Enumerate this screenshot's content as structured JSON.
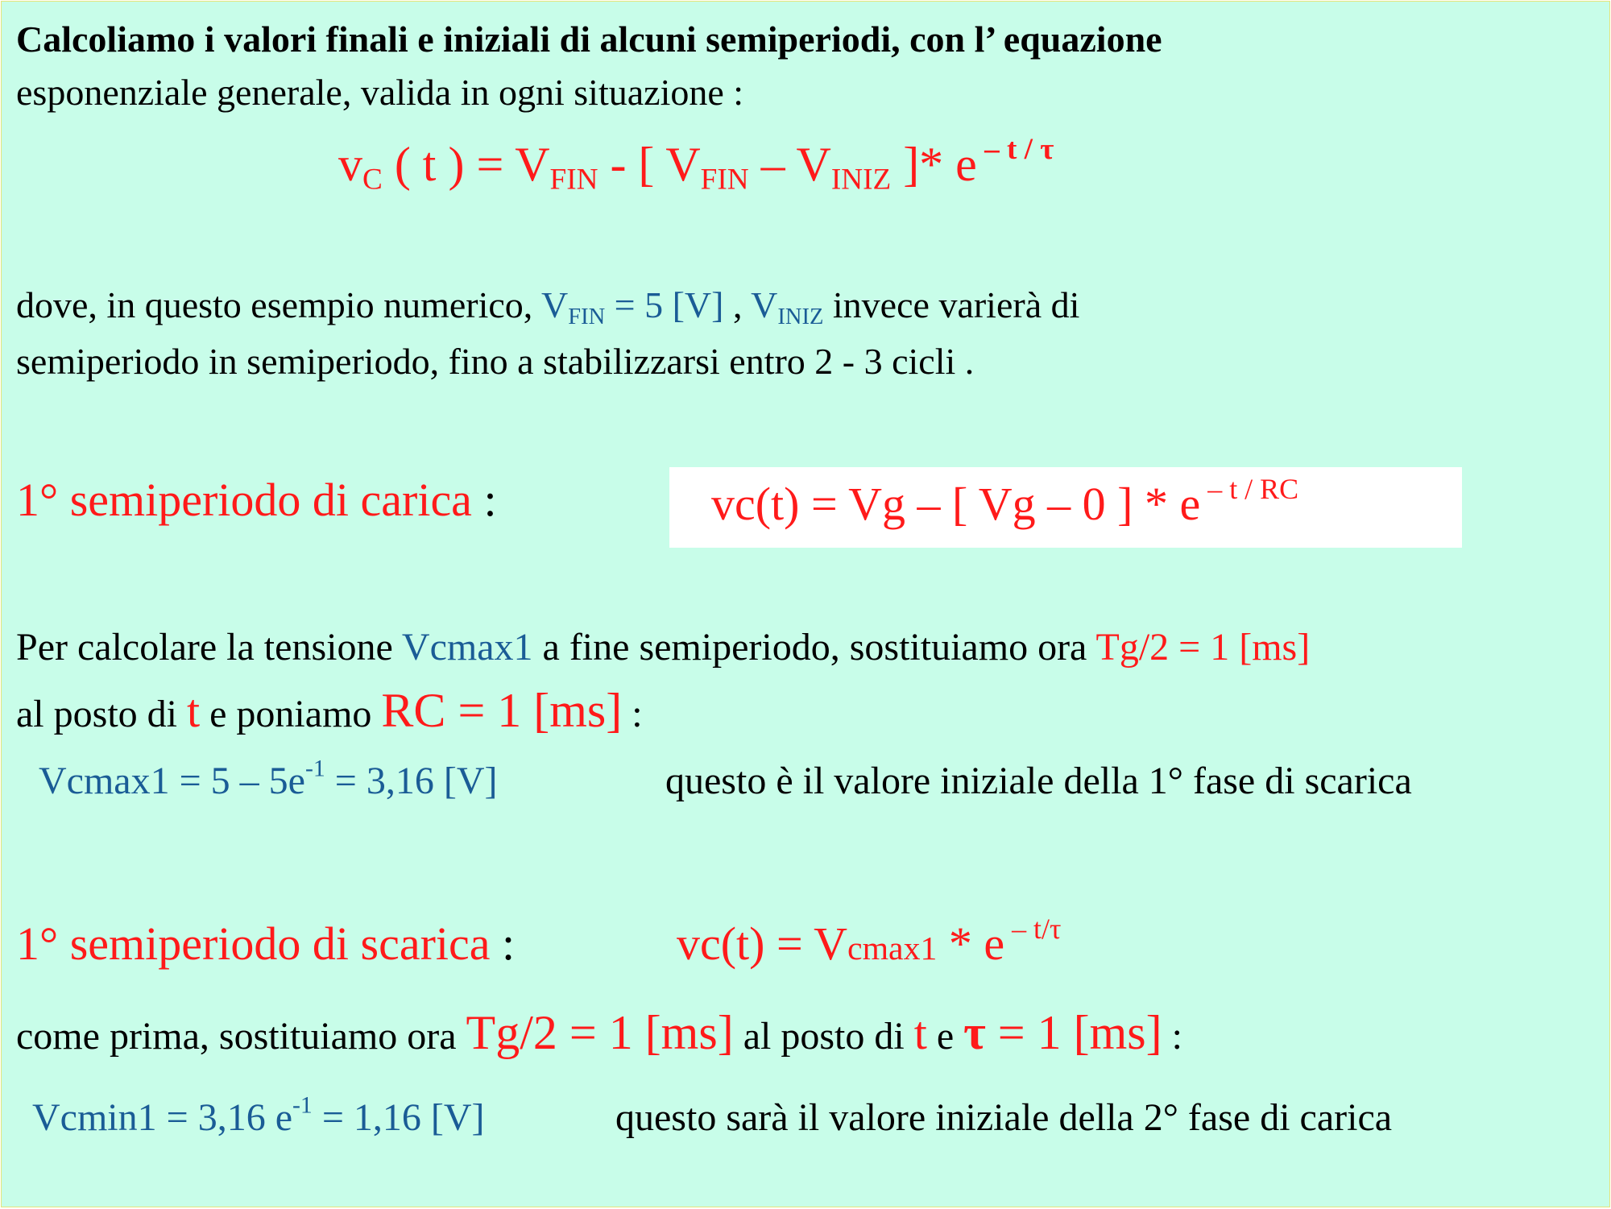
{
  "intro": {
    "line1": "Calcoliamo i valori finali e iniziali di alcuni semiperiodi, con l’ equazione",
    "line2": "esponenziale generale, valida in ogni situazione :"
  },
  "general_equation": {
    "v": "v",
    "v_sub": "C",
    "t_part": " ( t ) = V",
    "fin1": "FIN",
    "mid": " - [ V",
    "fin2": "FIN",
    "minus_v": " – V",
    "iniz": "INIZ",
    "close": " ]* e",
    "exp": " – t / τ"
  },
  "where": {
    "text1": "dove, in questo  esempio  numerico, ",
    "vfin_v": "V",
    "vfin_sub": "FIN",
    "vfin_val": " = 5 [V]",
    "comma": " ,  ",
    "viniz_v": "V",
    "viniz_sub": "INIZ",
    "text2": "   invece  varierà  di",
    "line2": "semiperiodo  in  semiperiodo, fino a stabilizzarsi  entro  2 - 3 cicli ."
  },
  "charge1": {
    "heading": "1° semiperiodo di carica",
    "colon": " :",
    "formula_lhs": "vc(t) = Vg  – [ Vg – 0 ] * e",
    "formula_exp": " – t / RC"
  },
  "calc_max": {
    "text1": "Per calcolare la tensione ",
    "vcmax": "Vcmax1",
    "text2": " a fine semiperiodo, sostituiamo ora ",
    "tg": "Tg/2 = 1 [ms]",
    "line2_a": "al posto di  ",
    "t": "t",
    "line2_b": "    e poniamo  ",
    "rc": "RC = 1 [ms]",
    "line2_c": "    :",
    "result_a": "Vcmax1 = 5  – 5e",
    "result_exp": "-1",
    "result_b": "  = 3,16  [V]",
    "result_note": "questo è il valore iniziale della 1° fase di scarica"
  },
  "discharge1": {
    "heading": "1° semiperiodo di scarica",
    "colon": " :",
    "f_a": "vc(t) =  V",
    "f_sub": "cmax1",
    "f_b": " * e",
    "f_exp": " – t/τ",
    "line_a": "come prima, sostituiamo ora ",
    "tg": "Tg/2 = 1 [ms]",
    "line_b": " al posto di  ",
    "t": "t",
    "line_c": "  e  ",
    "tau": "τ",
    "tau_val": " = 1 [ms]",
    "line_d": "    :",
    "result_a": "Vcmin1 = 3,16 e",
    "result_exp": "-1",
    "result_b": " = 1,16 [V]",
    "result_note": "questo sarà il valore iniziale della 2° fase di carica"
  },
  "colors": {
    "background": "#c8fde9",
    "red": "#ff1a1a",
    "blue": "#1a5c96",
    "box": "#ffffff"
  }
}
